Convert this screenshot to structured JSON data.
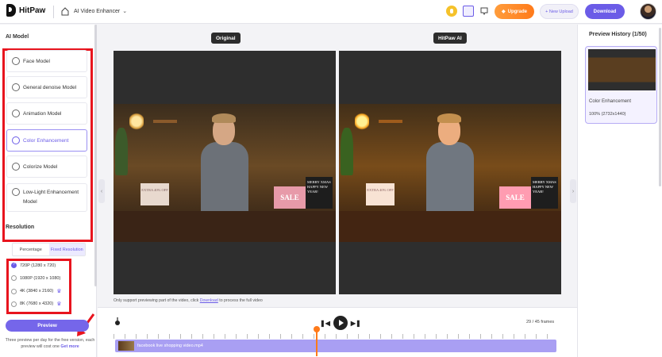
{
  "topbar": {
    "logo_text": "HitPaw",
    "app_name": "AI Video Enhancer",
    "upgrade_label": "Upgrade",
    "new_upload_label": "+ New Upload",
    "download_label": "Download"
  },
  "left": {
    "ai_model_title": "AI Model",
    "models": [
      {
        "label": "Face Model",
        "icon": "face-icon"
      },
      {
        "label": "General denoise Model",
        "icon": "denoise-icon"
      },
      {
        "label": "Animation Model",
        "icon": "animation-icon"
      },
      {
        "label": "Color Enhancement",
        "icon": "sun-icon",
        "active": true
      },
      {
        "label": "Colorize Model",
        "icon": "palette-icon"
      },
      {
        "label": "Low-Light Enhancement Model",
        "icon": "low-light-icon"
      }
    ],
    "resolution_title": "Resolution",
    "res_tabs": [
      "Percentage",
      "Fixed Resolution"
    ],
    "res_options": [
      {
        "label": "720P (1280 x 720)",
        "selected": true
      },
      {
        "label": "1080P (1920 x 1080)"
      },
      {
        "label": "4K (3840 x 2160)",
        "premium": true
      },
      {
        "label": "8K (7680 x 4320)",
        "premium": true
      }
    ],
    "preview_label": "Preview",
    "note_text": "Three preview per day for the free version, each preview will cost one",
    "get_more": "Get more"
  },
  "center": {
    "original_label": "Original",
    "hitpaw_label": "HitPaw AI",
    "sign_extra": "EXTRA 40% OFF",
    "sign_sale": "SALE",
    "sign_board": "MERRY XMAS HAPPY NEW YEAR!",
    "hint_prefix": "Only support previewing part of the video, click",
    "hint_link": "Download",
    "hint_suffix": "to process the full video",
    "frames": "29 / 45 frames",
    "track_label": "facebook live shopping video.mp4"
  },
  "right": {
    "title": "Preview History (1/50)",
    "item_name": "Color Enhancement",
    "item_meta": "100%  (2732x1440)"
  },
  "colors": {
    "accent": "#6b5ce7",
    "highlight_red": "#e8141e",
    "upgrade_orange": "#ff8a2a"
  }
}
